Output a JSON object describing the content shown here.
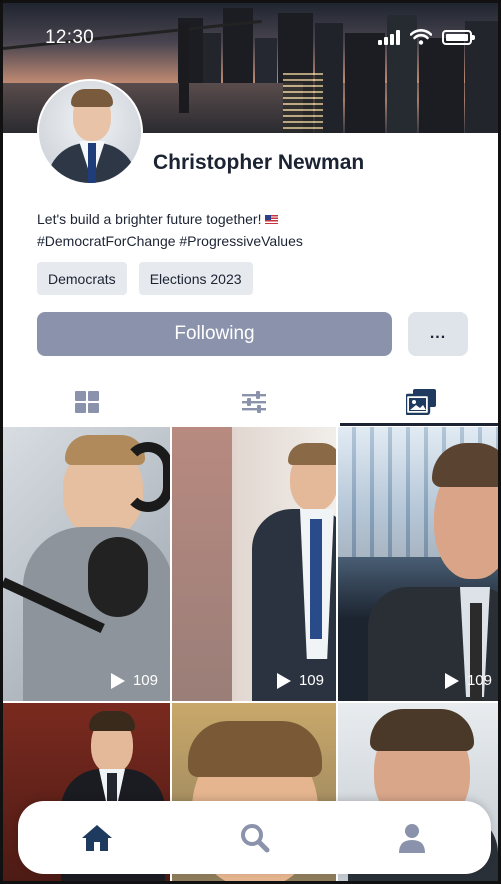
{
  "status_bar": {
    "time": "12:30"
  },
  "profile": {
    "name": "Christopher Newman",
    "bio_line1": "Let's build a brighter future together!",
    "bio_line2": "#DemocratForChange #ProgressiveValues",
    "tags": [
      "Democrats",
      "Elections 2023"
    ],
    "follow_label": "Following",
    "more_label": "..."
  },
  "tabs": [
    {
      "icon": "grid-icon",
      "active": false
    },
    {
      "icon": "sliders-icon",
      "active": false
    },
    {
      "icon": "media-icon",
      "active": true
    }
  ],
  "posts": [
    {
      "type": "video",
      "views": "109",
      "subject": "podcast-headphones"
    },
    {
      "type": "video",
      "views": "109",
      "subject": "man-in-suit-standing"
    },
    {
      "type": "video",
      "views": "109",
      "subject": "man-closeup"
    },
    {
      "type": "image",
      "subject": "man-red-background"
    },
    {
      "type": "image",
      "subject": "man-face-closeup"
    },
    {
      "type": "image",
      "subject": "man-office"
    }
  ],
  "bottom_nav": [
    {
      "icon": "home-icon",
      "active": true
    },
    {
      "icon": "search-icon",
      "active": false
    },
    {
      "icon": "profile-icon",
      "active": false
    }
  ],
  "colors": {
    "primary_text": "#1c2333",
    "follow_button": "#8a93ab",
    "tag_bg": "#e6e9ee",
    "active_icon": "#1e3a5f",
    "inactive_icon": "#8a93ab"
  }
}
